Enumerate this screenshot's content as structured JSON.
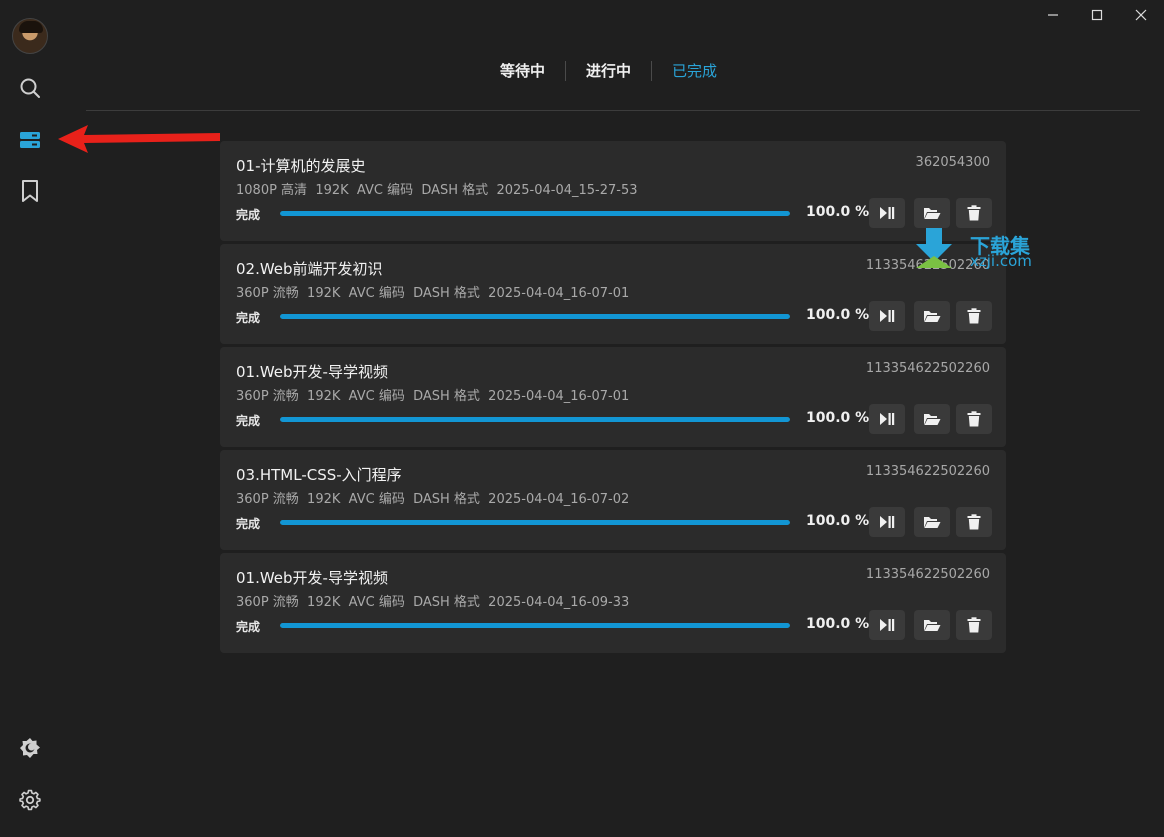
{
  "tabs": [
    {
      "label": "等待中",
      "active": false
    },
    {
      "label": "进行中",
      "active": false
    },
    {
      "label": "已完成",
      "active": true
    }
  ],
  "sidebar": {
    "items": [
      {
        "icon": "avatar"
      },
      {
        "icon": "search-icon"
      },
      {
        "icon": "downloads-icon",
        "active": true
      },
      {
        "icon": "bookmark-icon"
      },
      {
        "icon": "theme-icon"
      },
      {
        "icon": "settings-icon"
      }
    ]
  },
  "tasks": [
    {
      "title": "01-计算机的发展史",
      "id": "362054300",
      "meta": "1080P 高清  192K  AVC 编码  DASH 格式  2025-04-04_15-27-53",
      "status": "完成",
      "progress": 100,
      "percent_text": "100.0 %"
    },
    {
      "title": "02.Web前端开发初识",
      "id": "113354622502260",
      "meta": "360P 流畅  192K  AVC 编码  DASH 格式  2025-04-04_16-07-01",
      "status": "完成",
      "progress": 100,
      "percent_text": "100.0 %"
    },
    {
      "title": "01.Web开发-导学视频",
      "id": "113354622502260",
      "meta": "360P 流畅  192K  AVC 编码  DASH 格式  2025-04-04_16-07-01",
      "status": "完成",
      "progress": 100,
      "percent_text": "100.0 %"
    },
    {
      "title": "03.HTML-CSS-入门程序",
      "id": "113354622502260",
      "meta": "360P 流畅  192K  AVC 编码  DASH 格式  2025-04-04_16-07-02",
      "status": "完成",
      "progress": 100,
      "percent_text": "100.0 %"
    },
    {
      "title": "01.Web开发-导学视频",
      "id": "113354622502260",
      "meta": "360P 流畅  192K  AVC 编码  DASH 格式  2025-04-04_16-09-33",
      "status": "完成",
      "progress": 100,
      "percent_text": "100.0 %"
    }
  ],
  "watermark": {
    "title": "下载集",
    "domain": "xzji.com"
  },
  "colors": {
    "accent": "#1296d4",
    "background": "#1f1f1f",
    "card": "#2b2b2b",
    "annotation": "#e8211a"
  }
}
